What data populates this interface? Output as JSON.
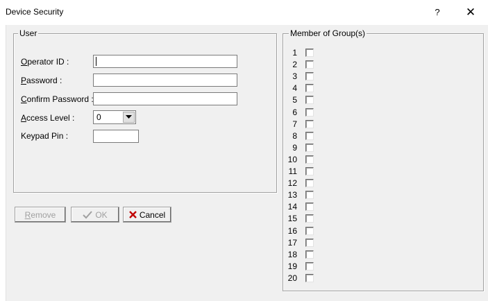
{
  "window": {
    "title": "Device Security",
    "help_label": "?",
    "close_label": "✕"
  },
  "user_group": {
    "legend": "User",
    "operator_id": {
      "accel": "O",
      "rest": "perator ID :",
      "value": ""
    },
    "password": {
      "accel": "P",
      "rest": "assword :",
      "value": ""
    },
    "confirm_password": {
      "accel": "C",
      "rest": "onfirm Password :",
      "value": ""
    },
    "access_level": {
      "accel": "A",
      "rest": "ccess Level :",
      "value": "0"
    },
    "keypad_pin": {
      "label": "Keypad Pin :",
      "value": ""
    }
  },
  "buttons": {
    "remove": {
      "accel": "R",
      "rest": "emove",
      "enabled": false
    },
    "ok": {
      "label": "OK",
      "enabled": false
    },
    "cancel": {
      "label": "Cancel",
      "enabled": true
    }
  },
  "groups": {
    "legend": "Member of Group(s)",
    "items": [
      "1",
      "2",
      "3",
      "4",
      "5",
      "6",
      "7",
      "8",
      "9",
      "10",
      "11",
      "12",
      "13",
      "14",
      "15",
      "16",
      "17",
      "18",
      "19",
      "20"
    ]
  },
  "colors": {
    "dialog_bg": "#f0f0f0",
    "cancel_icon": "#c00000",
    "check_icon_disabled": "#a0a0a0"
  }
}
